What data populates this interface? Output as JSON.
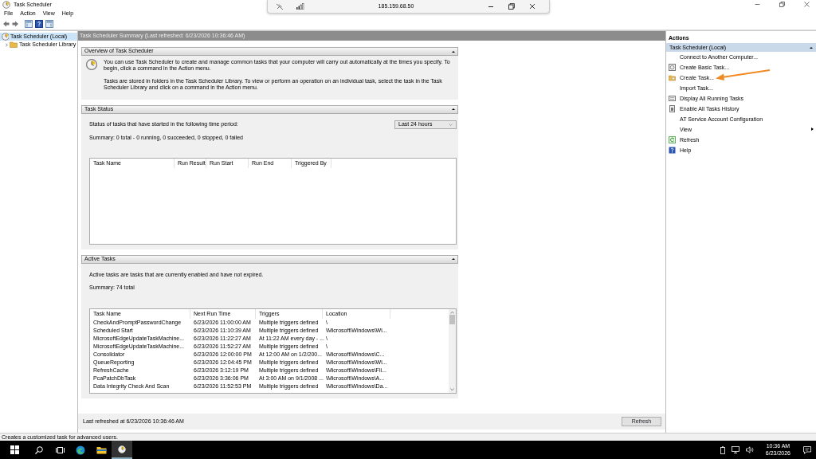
{
  "window": {
    "title": "Task Scheduler"
  },
  "menu": [
    "File",
    "Action",
    "View",
    "Help"
  ],
  "remote_bar": {
    "address": "185.159.68.50"
  },
  "tree": [
    {
      "label": "Task Scheduler (Local)",
      "selected": true,
      "children": [
        {
          "label": "Task Scheduler Library",
          "selected": false,
          "expanded": false
        }
      ]
    }
  ],
  "summary_header": "Task Scheduler Summary (Last refreshed: 6/23/2026 10:36:46 AM)",
  "overview": {
    "title": "Overview of Task Scheduler",
    "expanded": true,
    "paragraphs": [
      "You can use Task Scheduler to create and manage common tasks that your computer will carry out automatically at the times you specify. To begin, click a command in the Action menu.",
      "Tasks are stored in folders in the Task Scheduler Library. To view or perform an operation on an individual task, select the task in the Task Scheduler Library and click on a command in the Action menu."
    ]
  },
  "task_status": {
    "title": "Task Status",
    "expanded": true,
    "prompt": "Status of tasks that have started in the following time period:",
    "period": "Last 24 hours",
    "summary": "Summary: 0 total - 0 running, 0 succeeded, 0 stopped, 0 failed",
    "columns": [
      "Task Name",
      "Run Result",
      "Run Start",
      "Run End",
      "Triggered By"
    ]
  },
  "active_tasks": {
    "title": "Active Tasks",
    "expanded": true,
    "description": "Active tasks are tasks that are currently enabled and have not expired.",
    "summary": "Summary: 74 total",
    "columns": [
      "Task Name",
      "Next Run Time",
      "Triggers",
      "Location"
    ],
    "rows": [
      [
        "CheckAndPromptPasswordChange",
        "6/23/2026 11:00:00 AM",
        "Multiple triggers defined",
        "\\"
      ],
      [
        "Scheduled Start",
        "6/23/2026 11:10:39 AM",
        "Multiple triggers defined",
        "\\Microsoft\\Windows\\Wi..."
      ],
      [
        "MicrosoftEdgeUpdateTaskMachine...",
        "6/23/2026 11:22:27 AM",
        "At 11:22 AM every day - ...",
        "\\"
      ],
      [
        "MicrosoftEdgeUpdateTaskMachine...",
        "6/23/2026 11:52:27 AM",
        "Multiple triggers defined",
        "\\"
      ],
      [
        "Consolidator",
        "6/23/2026 12:00:00 PM",
        "At 12:00 AM on 1/2/200...",
        "\\Microsoft\\Windows\\C..."
      ],
      [
        "QueueReporting",
        "6/23/2026 12:04:45 PM",
        "Multiple triggers defined",
        "\\Microsoft\\Windows\\Wi..."
      ],
      [
        "RefreshCache",
        "6/23/2026 3:12:19 PM",
        "Multiple triggers defined",
        "\\Microsoft\\Windows\\Fli..."
      ],
      [
        "PcaPatchDbTask",
        "6/23/2026 3:36:06 PM",
        "At 3:00 AM on 9/1/2008 ...",
        "\\Microsoft\\Windows\\A..."
      ],
      [
        "Data Integrity Check And Scan",
        "6/23/2026 11:52:53 PM",
        "Multiple triggers defined",
        "\\Microsoft\\Windows\\Da..."
      ]
    ]
  },
  "footer": {
    "last_refreshed": "Last refreshed at 6/23/2026 10:36:46 AM",
    "button": "Refresh"
  },
  "actions": {
    "title": "Actions",
    "group": "Task Scheduler (Local)",
    "expanded": true,
    "items": [
      {
        "label": "Connect to Another Computer...",
        "kind": "plain"
      },
      {
        "label": "Create Basic Task...",
        "kind": "wizard"
      },
      {
        "label": "Create Task...",
        "kind": "folder"
      },
      {
        "label": "Import Task...",
        "kind": "plain"
      },
      {
        "label": "Display All Running Tasks",
        "kind": "list"
      },
      {
        "label": "Enable All Tasks History",
        "kind": "history"
      },
      {
        "label": "AT Service Account Configuration",
        "kind": "plain"
      },
      {
        "label": "View",
        "kind": "submenu"
      },
      {
        "label": "Refresh",
        "kind": "refresh"
      },
      {
        "label": "Help",
        "kind": "help"
      }
    ]
  },
  "status_bar": "Creates a customized task for advanced users.",
  "taskbar": {
    "time": "10:36 AM",
    "date": "6/23/2026"
  }
}
